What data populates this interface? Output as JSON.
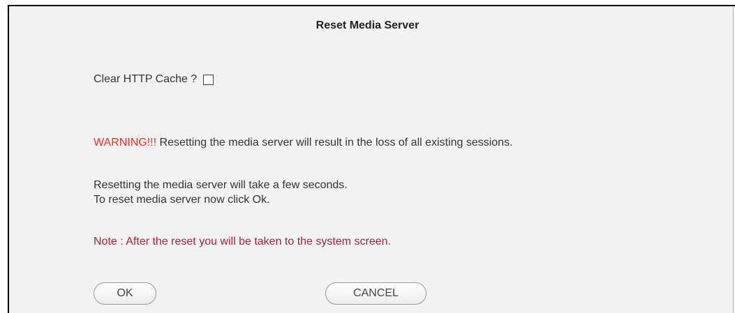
{
  "dialog": {
    "title": "Reset Media Server",
    "clear_cache_label": "Clear HTTP Cache ?",
    "clear_cache_checked": false,
    "warning_label": "WARNING!!!",
    "warning_text": " Resetting the media server will result in the loss of all existing sessions.",
    "info_line1": "Resetting the media server will take a few seconds.",
    "info_line2": "To reset media server now click Ok.",
    "note": "Note : After the reset you will be taken to the system screen.",
    "ok_label": "OK",
    "cancel_label": "CANCEL"
  },
  "colors": {
    "warning": "#e8322b",
    "note": "#a52538",
    "panel_background": "#f2f2f2"
  }
}
